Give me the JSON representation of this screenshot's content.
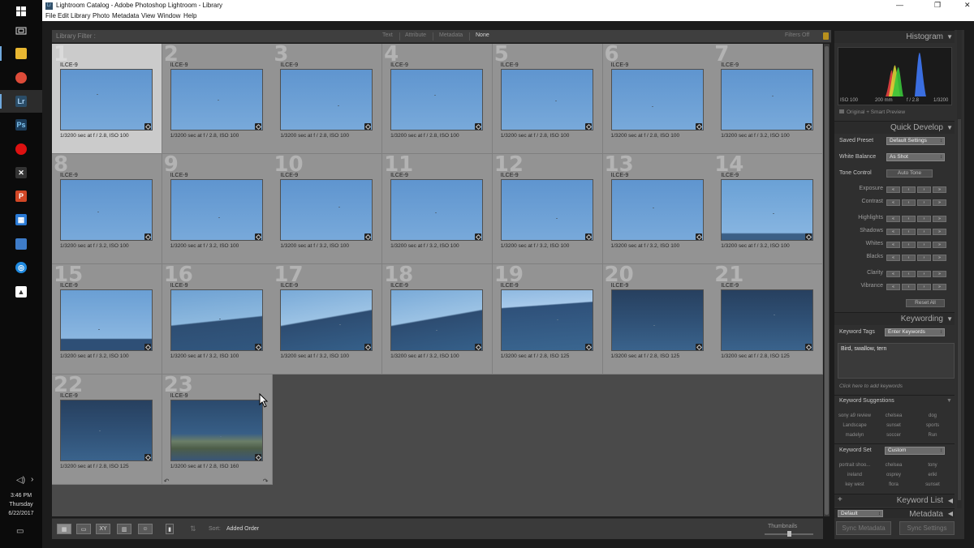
{
  "taskbar": {
    "clock_time": "3:46 PM",
    "clock_day": "Thursday",
    "clock_date": "6/22/2017"
  },
  "window": {
    "title": "Lightroom Catalog - Adobe Photoshop Lightroom - Library",
    "app_icon": "Lr",
    "menu": [
      "File",
      "Edit",
      "Library",
      "Photo",
      "Metadata",
      "View",
      "Window",
      "Help"
    ]
  },
  "filter_bar": {
    "label": "Library Filter :",
    "options": [
      "Text",
      "Attribute",
      "Metadata",
      "None"
    ],
    "selected": "None",
    "filters_off": "Filters Off"
  },
  "grid": {
    "cells": [
      {
        "index": "1",
        "camera": "ILCE-9",
        "exif": "1/3200 sec at f / 2.8, ISO 100",
        "selected": true,
        "scene": "sky"
      },
      {
        "index": "2",
        "camera": "ILCE-9",
        "exif": "1/3200 sec at f / 2.8, ISO 100",
        "scene": "sky"
      },
      {
        "index": "3",
        "camera": "ILCE-9",
        "exif": "1/3200 sec at f / 2.8, ISO 100",
        "scene": "sky"
      },
      {
        "index": "4",
        "camera": "ILCE-9",
        "exif": "1/3200 sec at f / 2.8, ISO 100",
        "scene": "sky"
      },
      {
        "index": "5",
        "camera": "ILCE-9",
        "exif": "1/3200 sec at f / 2.8, ISO 100",
        "scene": "sky"
      },
      {
        "index": "6",
        "camera": "ILCE-9",
        "exif": "1/3200 sec at f / 2.8, ISO 100",
        "scene": "sky"
      },
      {
        "index": "7",
        "camera": "ILCE-9",
        "exif": "1/3200 sec at f / 3.2, ISO 100",
        "scene": "sky"
      },
      {
        "index": "8",
        "camera": "ILCE-9",
        "exif": "1/3200 sec at f / 3.2, ISO 100",
        "scene": "sky"
      },
      {
        "index": "9",
        "camera": "ILCE-9",
        "exif": "1/3200 sec at f / 3.2, ISO 100",
        "scene": "sky"
      },
      {
        "index": "10",
        "camera": "ILCE-9",
        "exif": "1/3200 sec at f / 3.2, ISO 100",
        "scene": "sky"
      },
      {
        "index": "11",
        "camera": "ILCE-9",
        "exif": "1/3200 sec at f / 3.2, ISO 100",
        "scene": "sky"
      },
      {
        "index": "12",
        "camera": "ILCE-9",
        "exif": "1/3200 sec at f / 3.2, ISO 100",
        "scene": "sky"
      },
      {
        "index": "13",
        "camera": "ILCE-9",
        "exif": "1/3200 sec at f / 3.2, ISO 100",
        "scene": "sky"
      },
      {
        "index": "14",
        "camera": "ILCE-9",
        "exif": "1/3200 sec at f / 3.2, ISO 100",
        "scene": "sky-horizon"
      },
      {
        "index": "15",
        "camera": "ILCE-9",
        "exif": "1/3200 sec at f / 3.2, ISO 100",
        "scene": "sea-low"
      },
      {
        "index": "16",
        "camera": "ILCE-9",
        "exif": "1/3200 sec at f / 3.2, ISO 100",
        "scene": "sea-mid"
      },
      {
        "index": "17",
        "camera": "ILCE-9",
        "exif": "1/3200 sec at f / 3.2, ISO 100",
        "scene": "sea-tilt"
      },
      {
        "index": "18",
        "camera": "ILCE-9",
        "exif": "1/3200 sec at f / 3.2, ISO 100",
        "scene": "sea-tilt"
      },
      {
        "index": "19",
        "camera": "ILCE-9",
        "exif": "1/3200 sec at f / 2.8, ISO 125",
        "scene": "sea-half"
      },
      {
        "index": "20",
        "camera": "ILCE-9",
        "exif": "1/3200 sec at f / 2.8, ISO 125",
        "scene": "sea-full"
      },
      {
        "index": "21",
        "camera": "ILCE-9",
        "exif": "1/3200 sec at f / 2.8, ISO 125",
        "scene": "sea-full"
      },
      {
        "index": "22",
        "camera": "ILCE-9",
        "exif": "1/3200 sec at f / 2.8, ISO 125",
        "scene": "sea-full"
      },
      {
        "index": "23",
        "camera": "ILCE-9",
        "exif": "1/3200 sec at f / 2.8, ISO 160",
        "scene": "sea-waves"
      }
    ]
  },
  "toolbar": {
    "sort_label": "Sort:",
    "sort_value": "Added Order",
    "thumbnails_label": "Thumbnails",
    "thumbnails_level": 0.5
  },
  "histogram": {
    "title": "Histogram",
    "iso": "ISO 100",
    "focal": "200 mm",
    "aperture": "f / 2.8",
    "shutter": "1/3200",
    "preview": "Original + Smart Preview"
  },
  "quick_develop": {
    "title": "Quick Develop",
    "saved_preset_label": "Saved Preset",
    "saved_preset_value": "Default Settings",
    "white_balance_label": "White Balance",
    "white_balance_value": "As Shot",
    "tone_control_label": "Tone Control",
    "auto_tone": "Auto Tone",
    "sliders": [
      "Exposure",
      "Contrast",
      "Highlights",
      "Shadows",
      "Whites",
      "Blacks",
      "Clarity",
      "Vibrance"
    ],
    "reset_all": "Reset All"
  },
  "keywording": {
    "title": "Keywording",
    "tags_label": "Keyword Tags",
    "tags_mode": "Enter Keywords",
    "keywords": "Bird, swallow, tern",
    "hint": "Click here to add keywords",
    "suggestions_title": "Keyword Suggestions",
    "suggestions": [
      "sony a9 review",
      "chelsea",
      "dog",
      "Landscape",
      "sunset",
      "sports",
      "madelyn",
      "soccer",
      "Run"
    ],
    "set_label": "Keyword Set",
    "set_value": "Custom",
    "set_keywords": [
      "portrait shoo...",
      "chelsea",
      "tony",
      "ireland",
      "osprey",
      "erikl",
      "key west",
      "flora",
      "sunset"
    ]
  },
  "keyword_list": {
    "title": "Keyword List",
    "plus": "+"
  },
  "metadata": {
    "title": "Metadata",
    "preset": "Default"
  },
  "sync": {
    "metadata": "Sync Metadata",
    "settings": "Sync Settings"
  }
}
